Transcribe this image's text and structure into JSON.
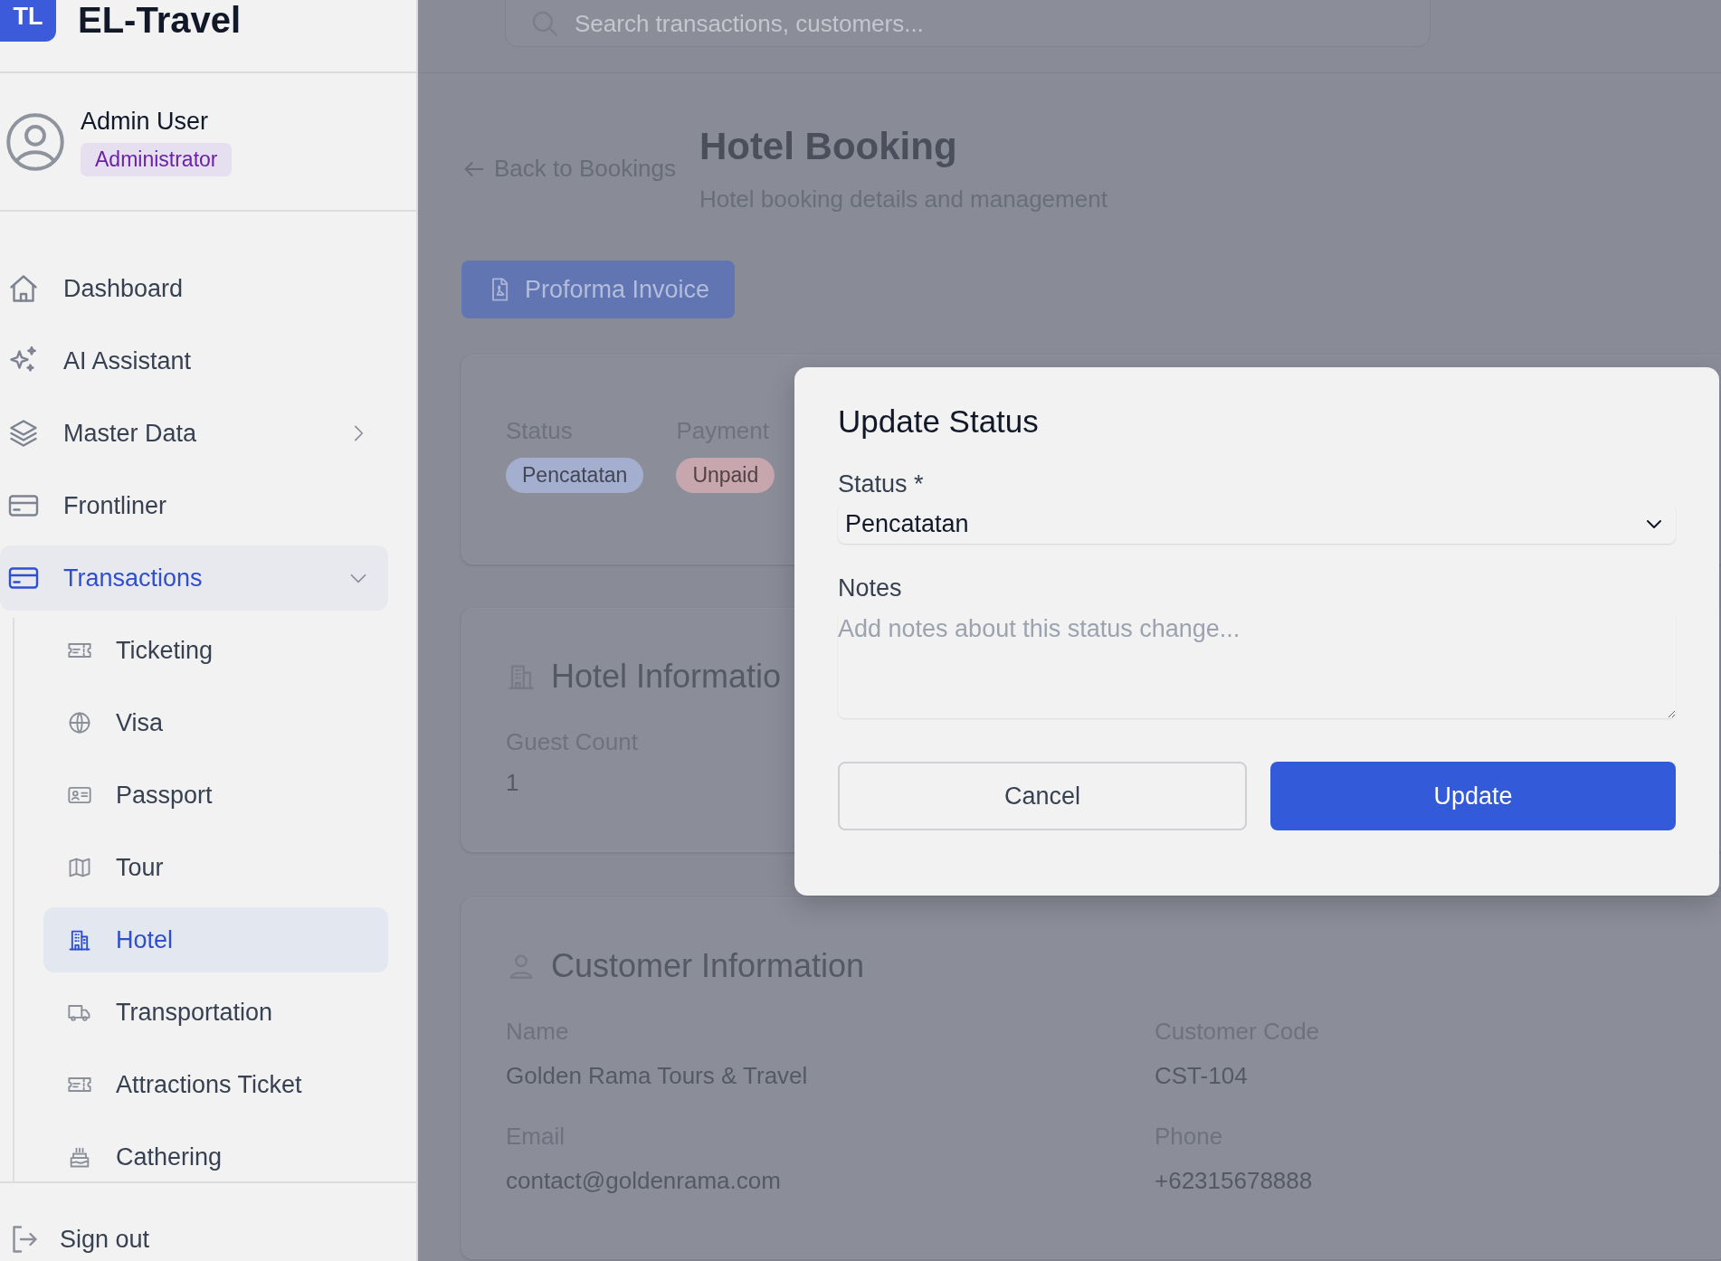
{
  "brand": {
    "logo": "TL",
    "name": "EL-Travel"
  },
  "user": {
    "name": "Admin User",
    "role": "Administrator"
  },
  "nav": [
    {
      "label": "Dashboard",
      "kind": "link",
      "selected": false
    },
    {
      "label": "AI Assistant",
      "kind": "link",
      "selected": false
    },
    {
      "label": "Master Data",
      "kind": "group",
      "selected": false,
      "expanded": false
    },
    {
      "label": "Frontliner",
      "kind": "link",
      "selected": false
    },
    {
      "label": "Transactions",
      "kind": "group",
      "selected": true,
      "expanded": true,
      "children": [
        {
          "label": "Ticketing",
          "selected": false
        },
        {
          "label": "Visa",
          "selected": false
        },
        {
          "label": "Passport",
          "selected": false
        },
        {
          "label": "Tour",
          "selected": false
        },
        {
          "label": "Hotel",
          "selected": true
        },
        {
          "label": "Transportation",
          "selected": false
        },
        {
          "label": "Attractions Ticket",
          "selected": false
        },
        {
          "label": "Cathering",
          "selected": false
        }
      ]
    }
  ],
  "sign_out": "Sign out",
  "search": {
    "placeholder": "Search transactions, customers..."
  },
  "back_link": "Back to Bookings",
  "page_title": "Hotel Booking",
  "page_subtitle": "Hotel booking details and management",
  "invoice_button": "Proforma Invoice",
  "status_card": {
    "fields": [
      {
        "label": "Status",
        "value": "Pencatatan",
        "color": "#a4afd0"
      },
      {
        "label": "Payment",
        "value": "Unpaid",
        "color": "#c8a6ae"
      }
    ]
  },
  "hotel_card": {
    "title": "Hotel Informatio",
    "fields": [
      {
        "label": "Guest Count",
        "value": "1"
      }
    ]
  },
  "customer_card": {
    "title": "Customer Information",
    "fields": [
      {
        "label": "Name",
        "value": "Golden Rama Tours & Travel"
      },
      {
        "label": "Customer Code",
        "value": "CST-104"
      },
      {
        "label": "Email",
        "value": "contact@goldenrama.com"
      },
      {
        "label": "Phone",
        "value": "+62315678888"
      }
    ]
  },
  "dialog": {
    "title": "Update Status",
    "status_label": "Status *",
    "status_value": "Pencatatan",
    "notes_label": "Notes",
    "notes_placeholder": "Add notes about this status change...",
    "buttons": [
      {
        "label": "Cancel",
        "kind": "secondary"
      },
      {
        "label": "Update",
        "kind": "primary"
      }
    ]
  }
}
